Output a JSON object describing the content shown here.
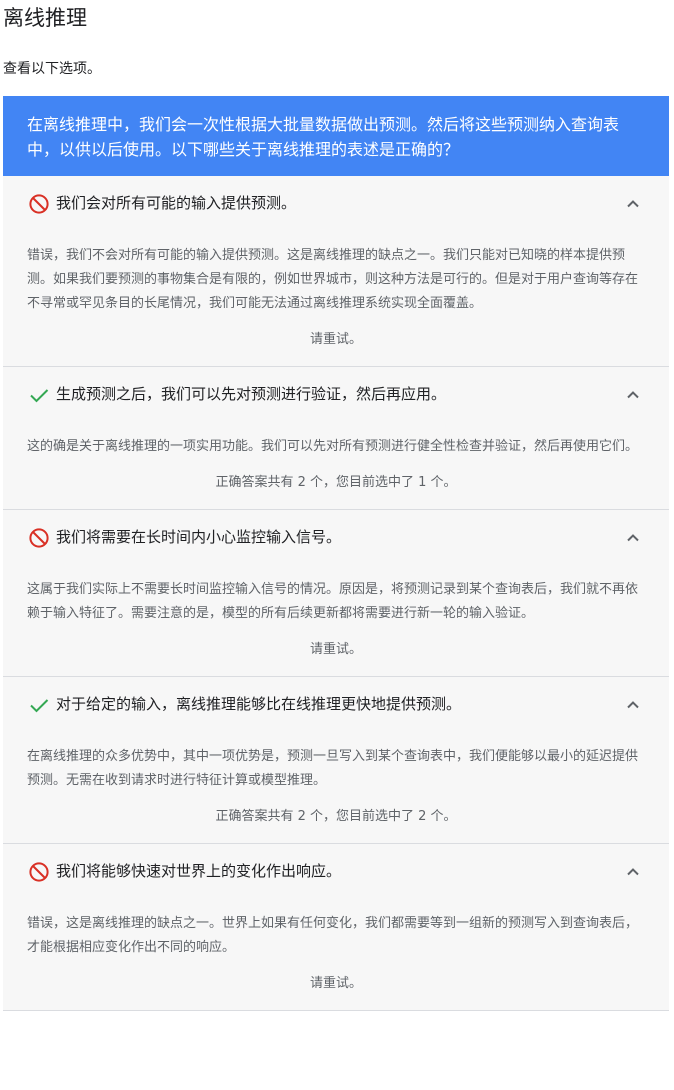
{
  "page": {
    "title": "离线推理",
    "intro": "查看以下选项。"
  },
  "question": {
    "text": "在离线推理中，我们会一次性根据大批量数据做出预测。然后将这些预测纳入查询表中，以供以后使用。以下哪些关于离线推理的表述是正确的？"
  },
  "colors": {
    "question_bg": "#4285f4",
    "correct": "#34a853",
    "wrong": "#d93025",
    "option_bg": "#f7f7f7"
  },
  "options": [
    {
      "status": "wrong",
      "icon": "prohibited-icon",
      "text": "我们会对所有可能的输入提供预测。",
      "explanation": "错误，我们不会对所有可能的输入提供预测。这是离线推理的缺点之一。我们只能对已知晓的样本提供预测。如果我们要预测的事物集合是有限的，例如世界城市，则这种方法是可行的。但是对于用户查询等存在不寻常或罕见条目的长尾情况，我们可能无法通过离线推理系统实现全面覆盖。",
      "verdict": "请重试。"
    },
    {
      "status": "correct",
      "icon": "checkmark-icon",
      "text": "生成预测之后，我们可以先对预测进行验证，然后再应用。",
      "explanation": "这的确是关于离线推理的一项实用功能。我们可以先对所有预测进行健全性检查并验证，然后再使用它们。",
      "verdict": "正确答案共有 2 个，您目前选中了 1 个。"
    },
    {
      "status": "wrong",
      "icon": "prohibited-icon",
      "text": "我们将需要在长时间内小心监控输入信号。",
      "explanation": "这属于我们实际上不需要长时间监控输入信号的情况。原因是，将预测记录到某个查询表后，我们就不再依赖于输入特征了。需要注意的是，模型的所有后续更新都将需要进行新一轮的输入验证。",
      "verdict": "请重试。"
    },
    {
      "status": "correct",
      "icon": "checkmark-icon",
      "text": "对于给定的输入，离线推理能够比在线推理更快地提供预测。",
      "explanation": "在离线推理的众多优势中，其中一项优势是，预测一旦写入到某个查询表中，我们便能够以最小的延迟提供预测。无需在收到请求时进行特征计算或模型推理。",
      "verdict": "正确答案共有 2 个，您目前选中了 2 个。"
    },
    {
      "status": "wrong",
      "icon": "prohibited-icon",
      "text": "我们将能够快速对世界上的变化作出响应。",
      "explanation": "错误，这是离线推理的缺点之一。世界上如果有任何变化，我们都需要等到一组新的预测写入到查询表后，才能根据相应变化作出不同的响应。",
      "verdict": "请重试。"
    }
  ]
}
